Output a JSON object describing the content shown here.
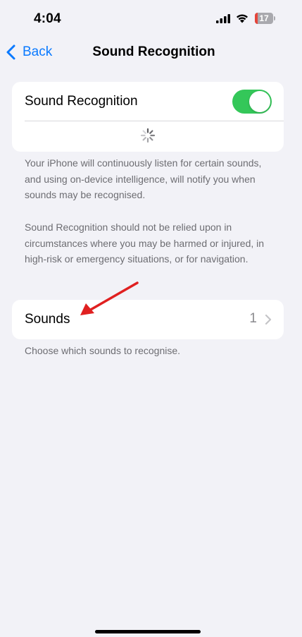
{
  "status_bar": {
    "time": "4:04",
    "battery_level": "17",
    "battery_fraction": 0.17,
    "battery_color": "#e5443a",
    "icons": [
      "cellular-signal-icon",
      "wifi-icon",
      "battery-icon"
    ]
  },
  "nav": {
    "back_label": "Back",
    "back_icon": "chevron-left-icon",
    "title": "Sound Recognition"
  },
  "sound_recognition": {
    "label": "Sound Recognition",
    "enabled": true,
    "toggle_color": "#34c759",
    "loading_icon": "activity-spinner-icon"
  },
  "description": {
    "paragraph1": "Your iPhone will continuously listen for certain sounds, and using on-device intelligence, will notify you when sounds may be recognised.",
    "paragraph2": "Sound Recognition should not be relied upon in circumstances where you may be harmed or injured, in high-risk or emergency situations, or for navigation."
  },
  "sounds": {
    "label": "Sounds",
    "count": "1",
    "chevron_icon": "chevron-right-icon",
    "footnote": "Choose which sounds to recognise."
  },
  "annotation": {
    "arrow_icon": "red-arrow-icon",
    "arrow_color": "#e02020"
  },
  "colors": {
    "accent": "#0a7aff",
    "background": "#f2f2f7",
    "secondary_text": "#6d6d72"
  }
}
